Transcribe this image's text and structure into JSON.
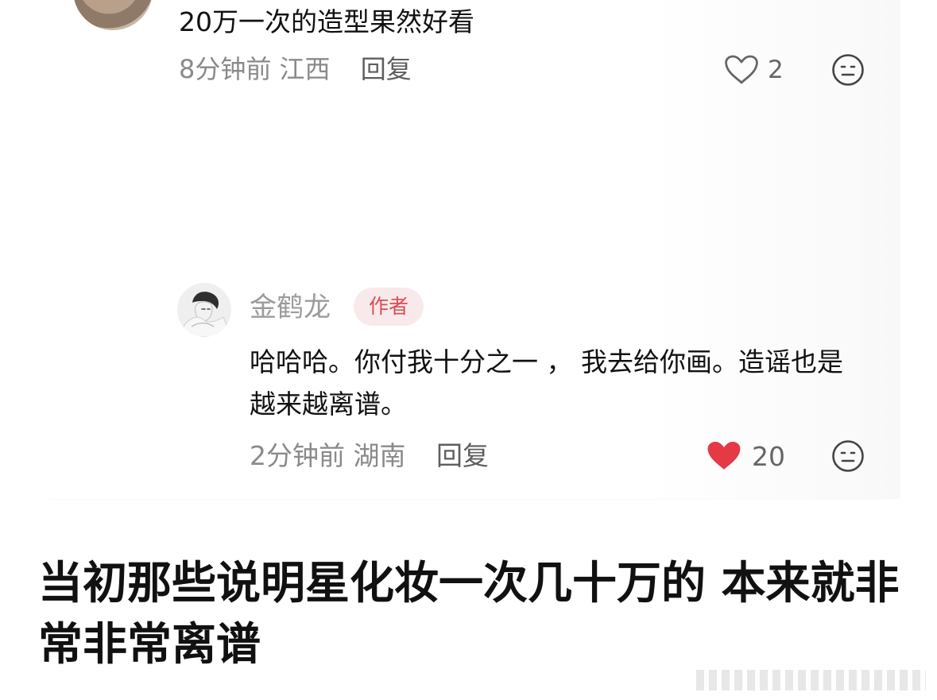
{
  "top_comment": {
    "text": "20万一次的造型果然好看",
    "time": "8分钟前",
    "location": "江西",
    "reply_label": "回复",
    "like_count": "2",
    "icons": {
      "like": "heart-outline-icon",
      "react": "face-icon"
    }
  },
  "reply_comment": {
    "username": "金鹤龙",
    "badge": "作者",
    "text": "哈哈哈。你付我十分之一 ， 我去给你画。造谣也是越来越离谱。",
    "time": "2分钟前",
    "location": "湖南",
    "reply_label": "回复",
    "like_count": "20",
    "icons": {
      "like": "heart-filled-icon",
      "react": "face-icon"
    }
  },
  "caption": {
    "text": "当初那些说明星化妆一次几十万的 本来就非常非常离谱"
  },
  "colors": {
    "heart_active": "#e53945",
    "badge_text": "#d94b57",
    "badge_bg": "#f8eaea",
    "meta_text": "#8a8a8a"
  }
}
